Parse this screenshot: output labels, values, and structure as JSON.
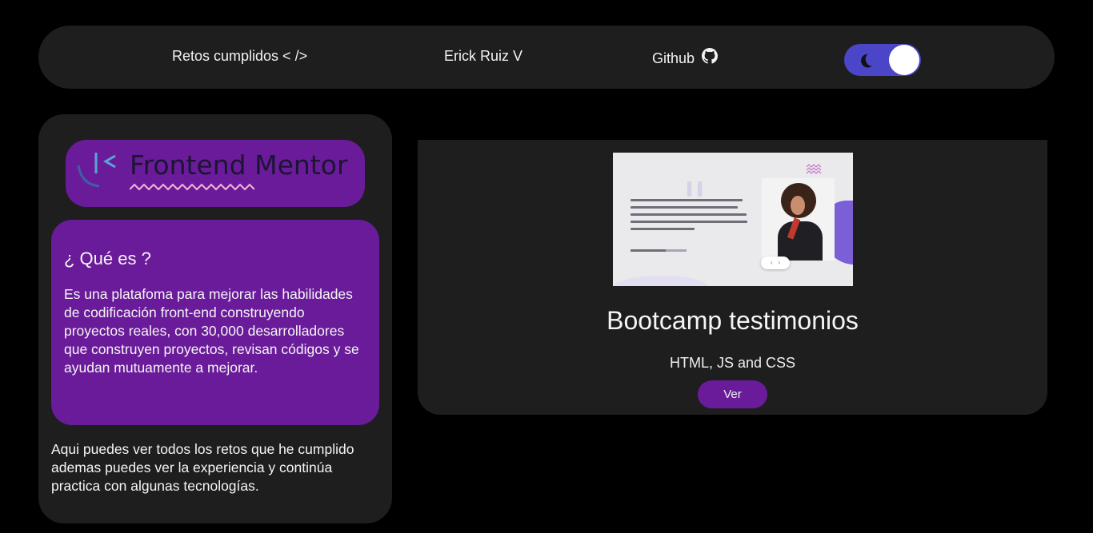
{
  "nav": {
    "retos_label": "Retos cumplidos < />",
    "author_label": "Erick Ruiz V",
    "github_label": "Github",
    "github_icon": "github-icon",
    "theme_toggle": {
      "icon": "moon-icon",
      "state": "dark"
    }
  },
  "sidebar": {
    "logo_text": "Frontend Mentor",
    "que_es": {
      "title": "¿ Qué es ?",
      "text": "Es una platafoma para mejorar las habilidades de codificación front-end construyendo proyectos reales, con 30,000 desarrolladores que construyen proyectos, revisan códigos y se ayudan mutuamente a mejorar."
    },
    "retos_text": "Aqui puedes ver todos los retos que he cumplido ademas puedes ver la experiencia y continúa practica con algunas tecnologías."
  },
  "project": {
    "title": "Bootcamp testimonios",
    "tech": "HTML, JS and CSS",
    "button_label": "Ver"
  },
  "colors": {
    "background": "#000000",
    "panel": "#1e1e1e",
    "accent_purple": "#6a1b9a",
    "toggle_blue": "#4b45c8"
  }
}
